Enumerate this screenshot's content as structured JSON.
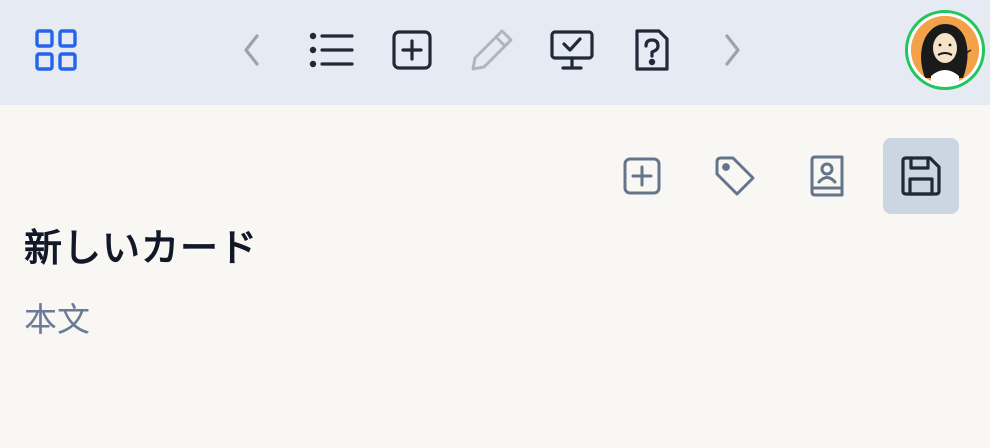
{
  "topbar": {
    "icons": [
      "grid-icon",
      "chevron-left-icon",
      "list-icon",
      "plus-square-icon",
      "pencil-icon",
      "monitor-check-icon",
      "file-question-icon",
      "chevron-right-icon"
    ],
    "avatar": "avatar-portrait"
  },
  "card_toolbar": {
    "icons": [
      "plus-square-icon",
      "tag-icon",
      "contact-book-icon",
      "save-icon"
    ],
    "active": "save-icon"
  },
  "card": {
    "title": "新しいカード",
    "body": "本文"
  },
  "colors": {
    "accent_blue": "#2563eb",
    "icon_dark": "#1f2937",
    "icon_muted": "#9ca3af",
    "icon_slate": "#64748b",
    "avatar_ring": "#22c55e",
    "active_bg": "#cbd6e2",
    "topbar_bg": "#e6eaf3",
    "content_bg": "#f9f7f4"
  }
}
